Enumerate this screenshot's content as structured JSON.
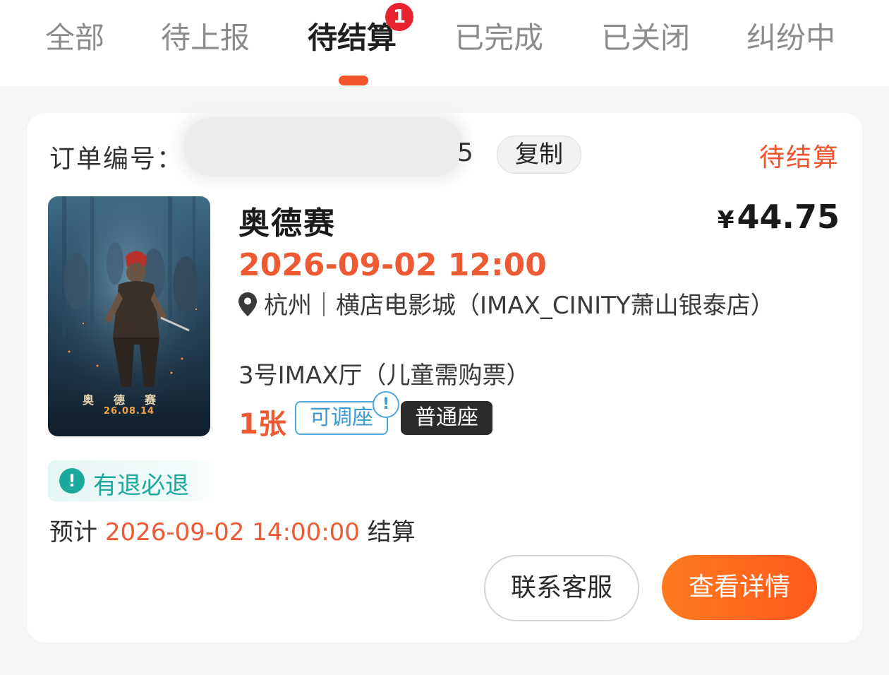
{
  "tabs": {
    "items": [
      {
        "label": "全部"
      },
      {
        "label": "待上报"
      },
      {
        "label": "待结算",
        "badge": "1"
      },
      {
        "label": "已完成"
      },
      {
        "label": "已关闭"
      },
      {
        "label": "纠纷中"
      }
    ],
    "active_index": 2
  },
  "order": {
    "number_label": "订单编号：",
    "number_visible_suffix": "5",
    "copy_label": "复制",
    "status": "待结算",
    "movie_title": "奥德赛",
    "currency": "¥",
    "price": "44.75",
    "showtime": "2026-09-02 12:00",
    "venue": "杭州｜横店电影城（IMAX_CINITY萧山银泰店）",
    "hall": "3号IMAX厅（儿童需购票）",
    "ticket_count": "1张",
    "tag_adjustable": "可调座",
    "tag_alert": "!",
    "seat_type": "普通座",
    "refund_label": "有退必退",
    "settle_prefix": "预计",
    "settle_time": "2026-09-02 14:00:00",
    "settle_suffix": "结算",
    "service_button": "联系客服",
    "detail_button": "查看详情"
  },
  "poster": {
    "title": "奥德赛",
    "date": "26.08.14"
  },
  "colors": {
    "accent": "#f0542d",
    "teal": "#1aa99c",
    "blue_tag": "#3d9bd2",
    "badge_red": "#e8232f"
  },
  "icons": {
    "location": "map-pin-icon",
    "refund": "exclamation-circle-icon"
  }
}
